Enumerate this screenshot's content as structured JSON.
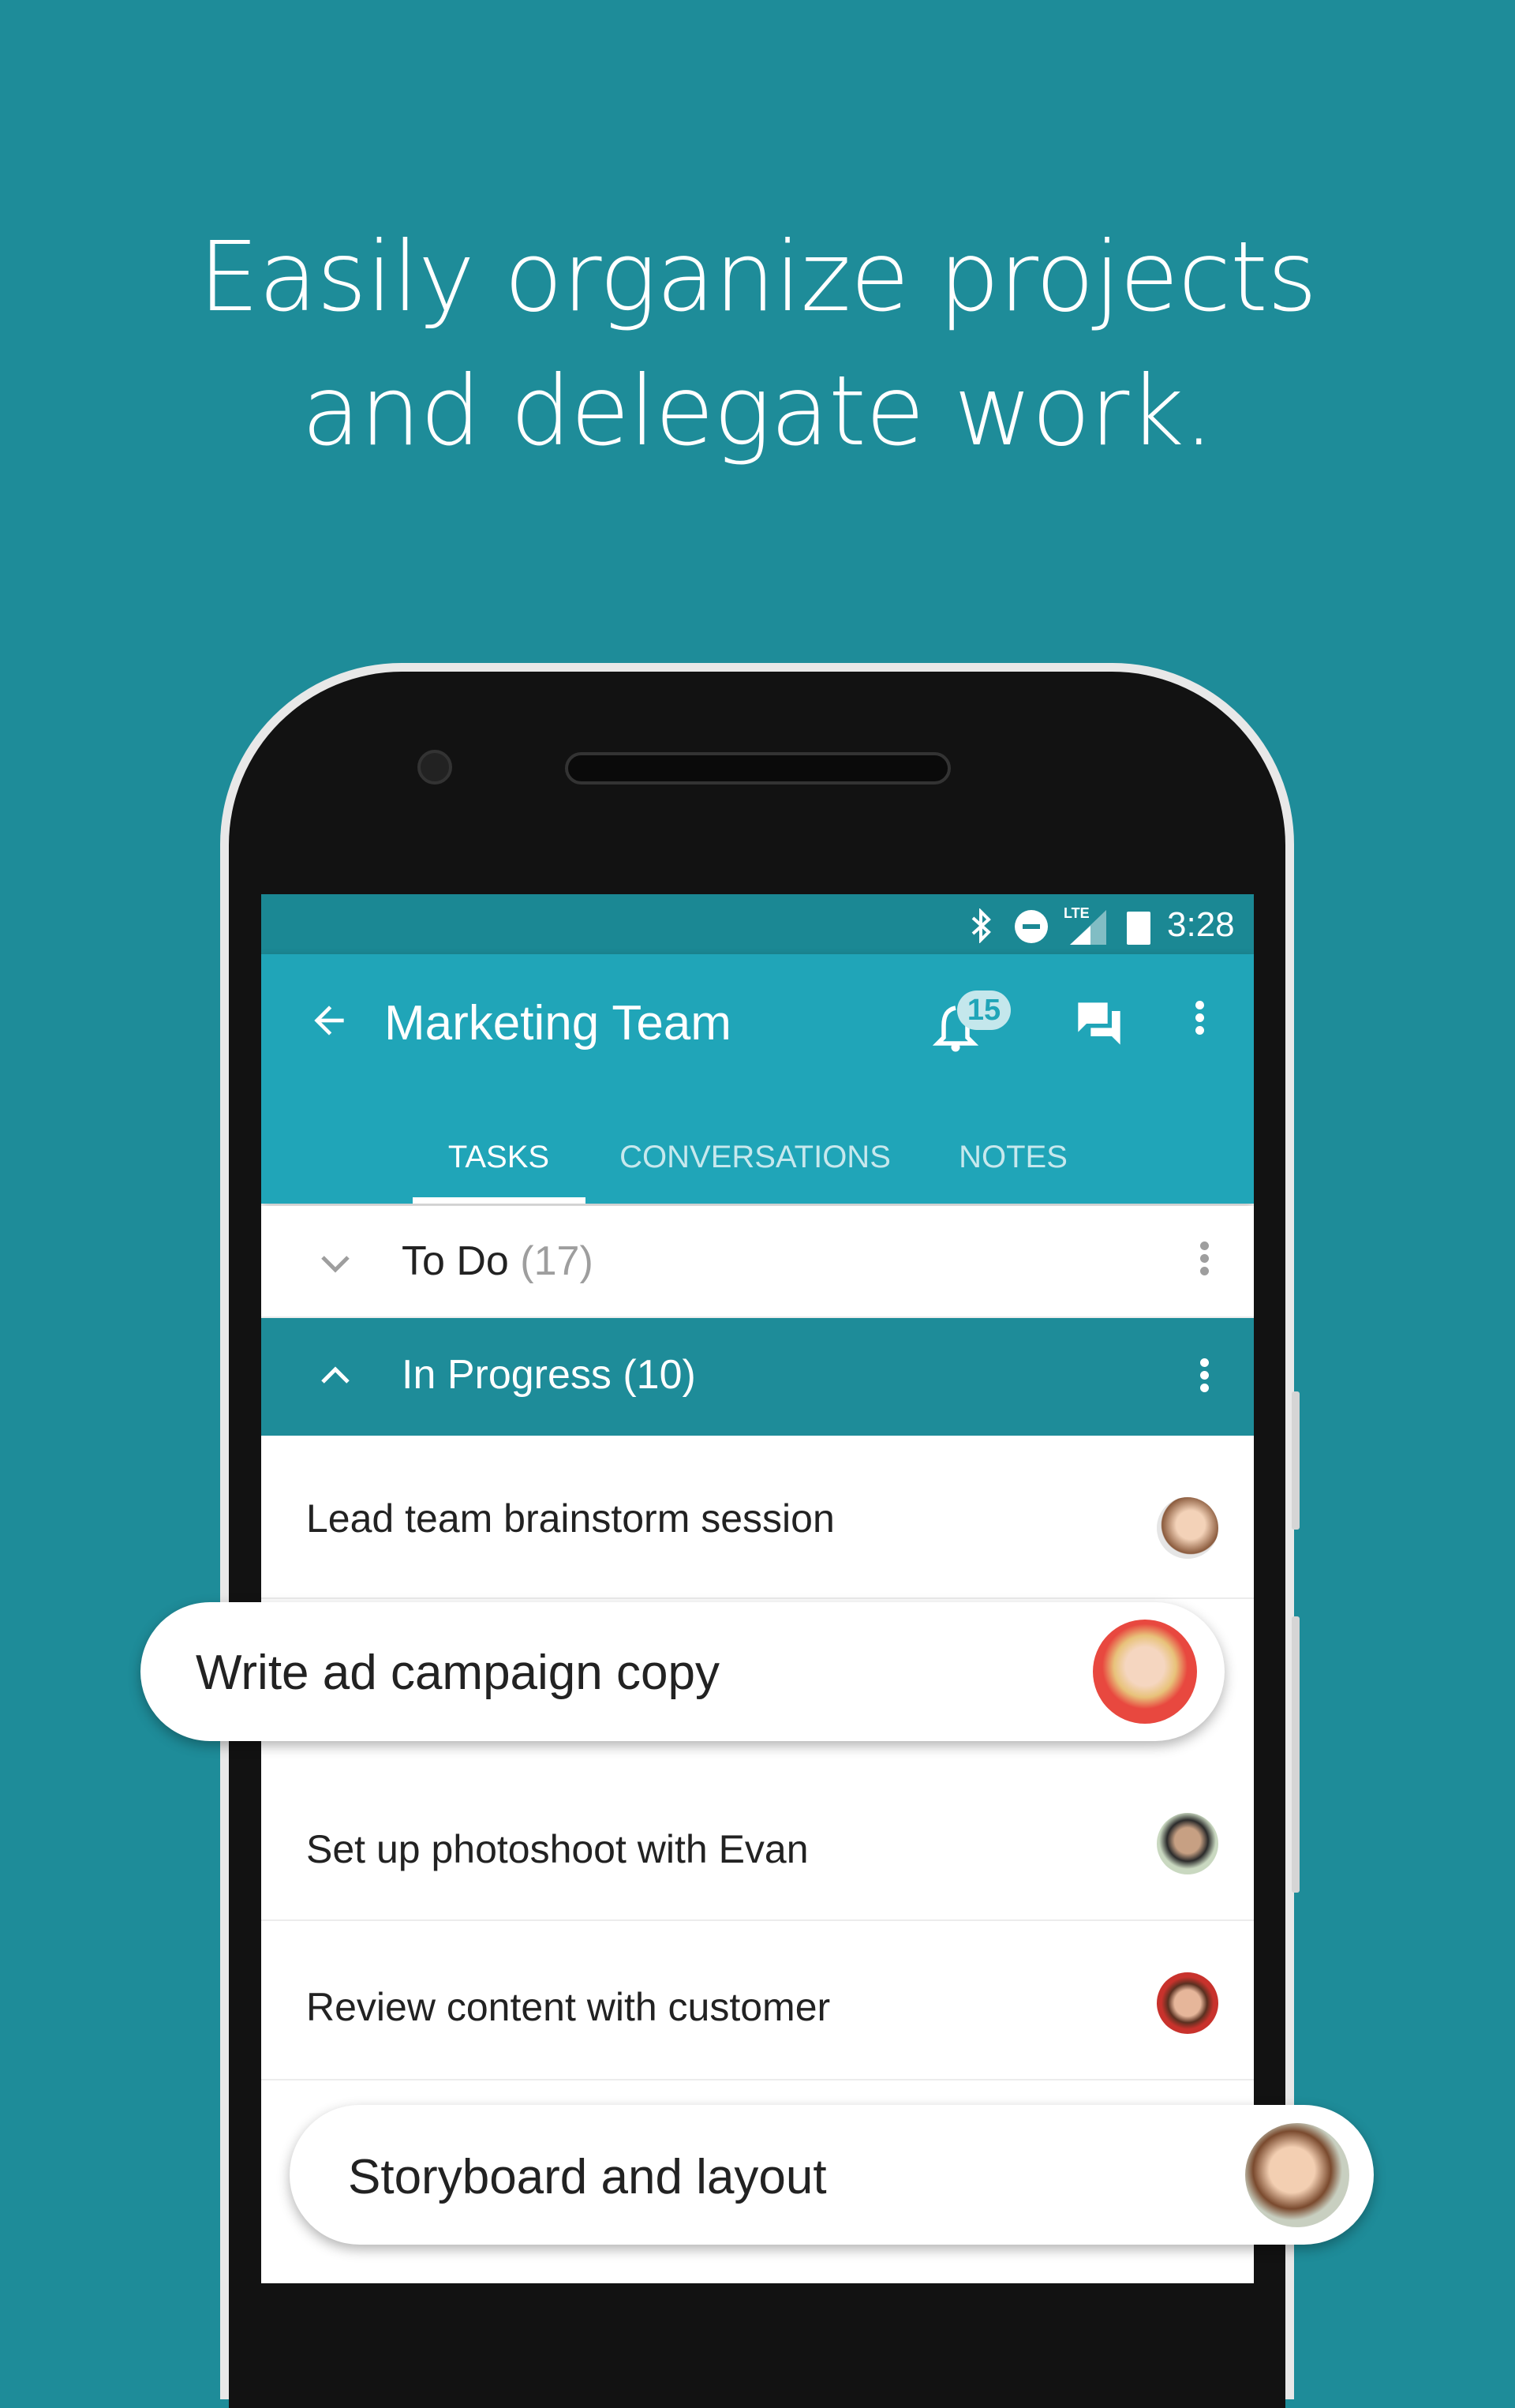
{
  "headline": {
    "line1": "Easily organize projects",
    "line2": "and delegate work."
  },
  "status_bar": {
    "time": "3:28",
    "network": "LTE",
    "icons": [
      "bluetooth-icon",
      "do-not-disturb-icon",
      "signal-icon",
      "battery-icon"
    ]
  },
  "toolbar": {
    "title": "Marketing Team",
    "notification_count": "15"
  },
  "tabs": [
    {
      "label": "TASKS",
      "active": true
    },
    {
      "label": "CONVERSATIONS"
    },
    {
      "label": "NOTES"
    }
  ],
  "sections": [
    {
      "title": "To Do",
      "count": "(17)",
      "expanded": false
    },
    {
      "title": "In Progress",
      "count": "(10)",
      "expanded": true
    }
  ],
  "tasks": [
    {
      "title": "Lead team brainstorm session"
    },
    {
      "title": "Write ad campaign copy"
    },
    {
      "title": "Set up photoshoot with Evan"
    },
    {
      "title": "Review content with customer"
    },
    {
      "title": "Storyboard and layout"
    }
  ],
  "colors": {
    "background": "#1e8c99",
    "toolbar": "#20a5b8",
    "status_bar": "#1b8894",
    "section_active": "#1e8c99"
  }
}
